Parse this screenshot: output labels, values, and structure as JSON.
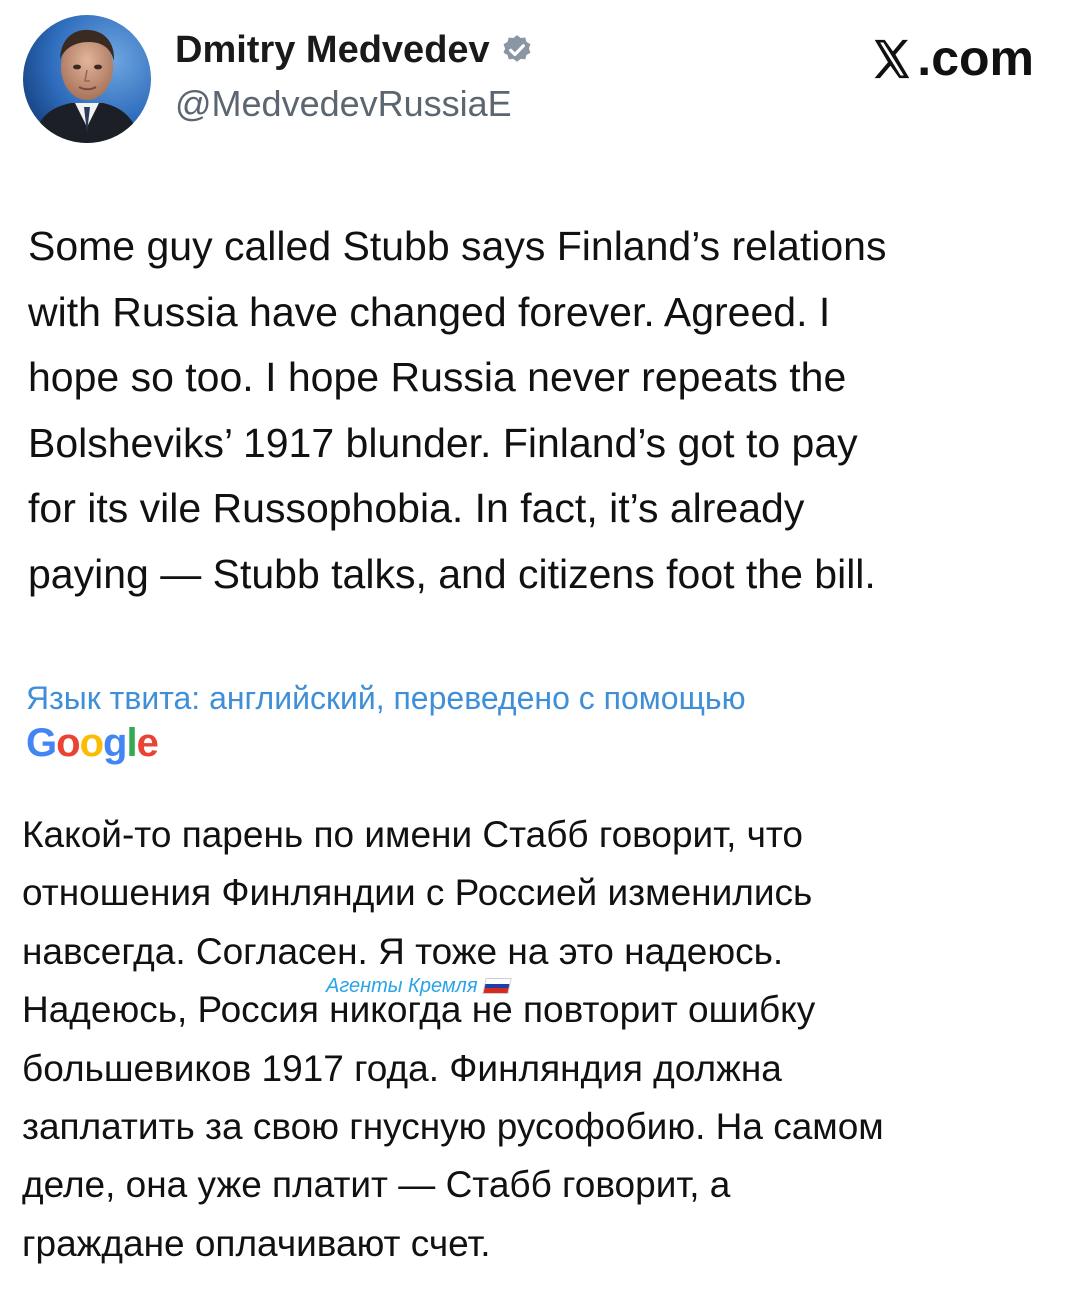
{
  "profile": {
    "display_name": "Dmitry Medvedev",
    "handle": "@MedvedevRussiaE",
    "verified_icon": "verified-badge-icon",
    "verified_color": "#8a96a3"
  },
  "brand": {
    "label": ".com",
    "icon": "x-logo-icon"
  },
  "tweet": {
    "lines": [
      "Some guy called Stubb says Finland’s relations",
      "with Russia have changed forever. Agreed. I",
      "hope so too. I hope Russia never repeats the",
      "Bolsheviks’ 1917 blunder. Finland’s got to pay",
      "for its vile Russophobia. In fact, it’s already",
      "paying — Stubb talks, and citizens foot the bill."
    ]
  },
  "translation": {
    "note": "Язык твита: английский, переведено с помощью",
    "note_color": "#3f8fd8",
    "provider_letters": [
      {
        "ch": "G",
        "color": "#4285F4"
      },
      {
        "ch": "o",
        "color": "#EA4335"
      },
      {
        "ch": "o",
        "color": "#FBBC05"
      },
      {
        "ch": "g",
        "color": "#4285F4"
      },
      {
        "ch": "l",
        "color": "#34A853"
      },
      {
        "ch": "e",
        "color": "#EA4335"
      }
    ],
    "lines": [
      "Какой-то парень по имени Стабб говорит, что",
      "отношения Финляндии с Россией изменились",
      "навсегда. Согласен. Я тоже на это надеюсь.",
      "Надеюсь, Россия никогда не повторит ошибку",
      "большевиков 1917 года. Финляндия должна",
      "заплатить за свою гнусную русофобию. На самом",
      "деле, она уже платит — Стабб говорит, а",
      "граждане оплачивают счет."
    ]
  },
  "watermark": {
    "text": "Агенты Кремля",
    "flag_icon": "russian-flag-icon",
    "flag_colors": [
      "#ffffff",
      "#1c3fa8",
      "#d52b1e"
    ],
    "color": "#2aa3e8"
  }
}
